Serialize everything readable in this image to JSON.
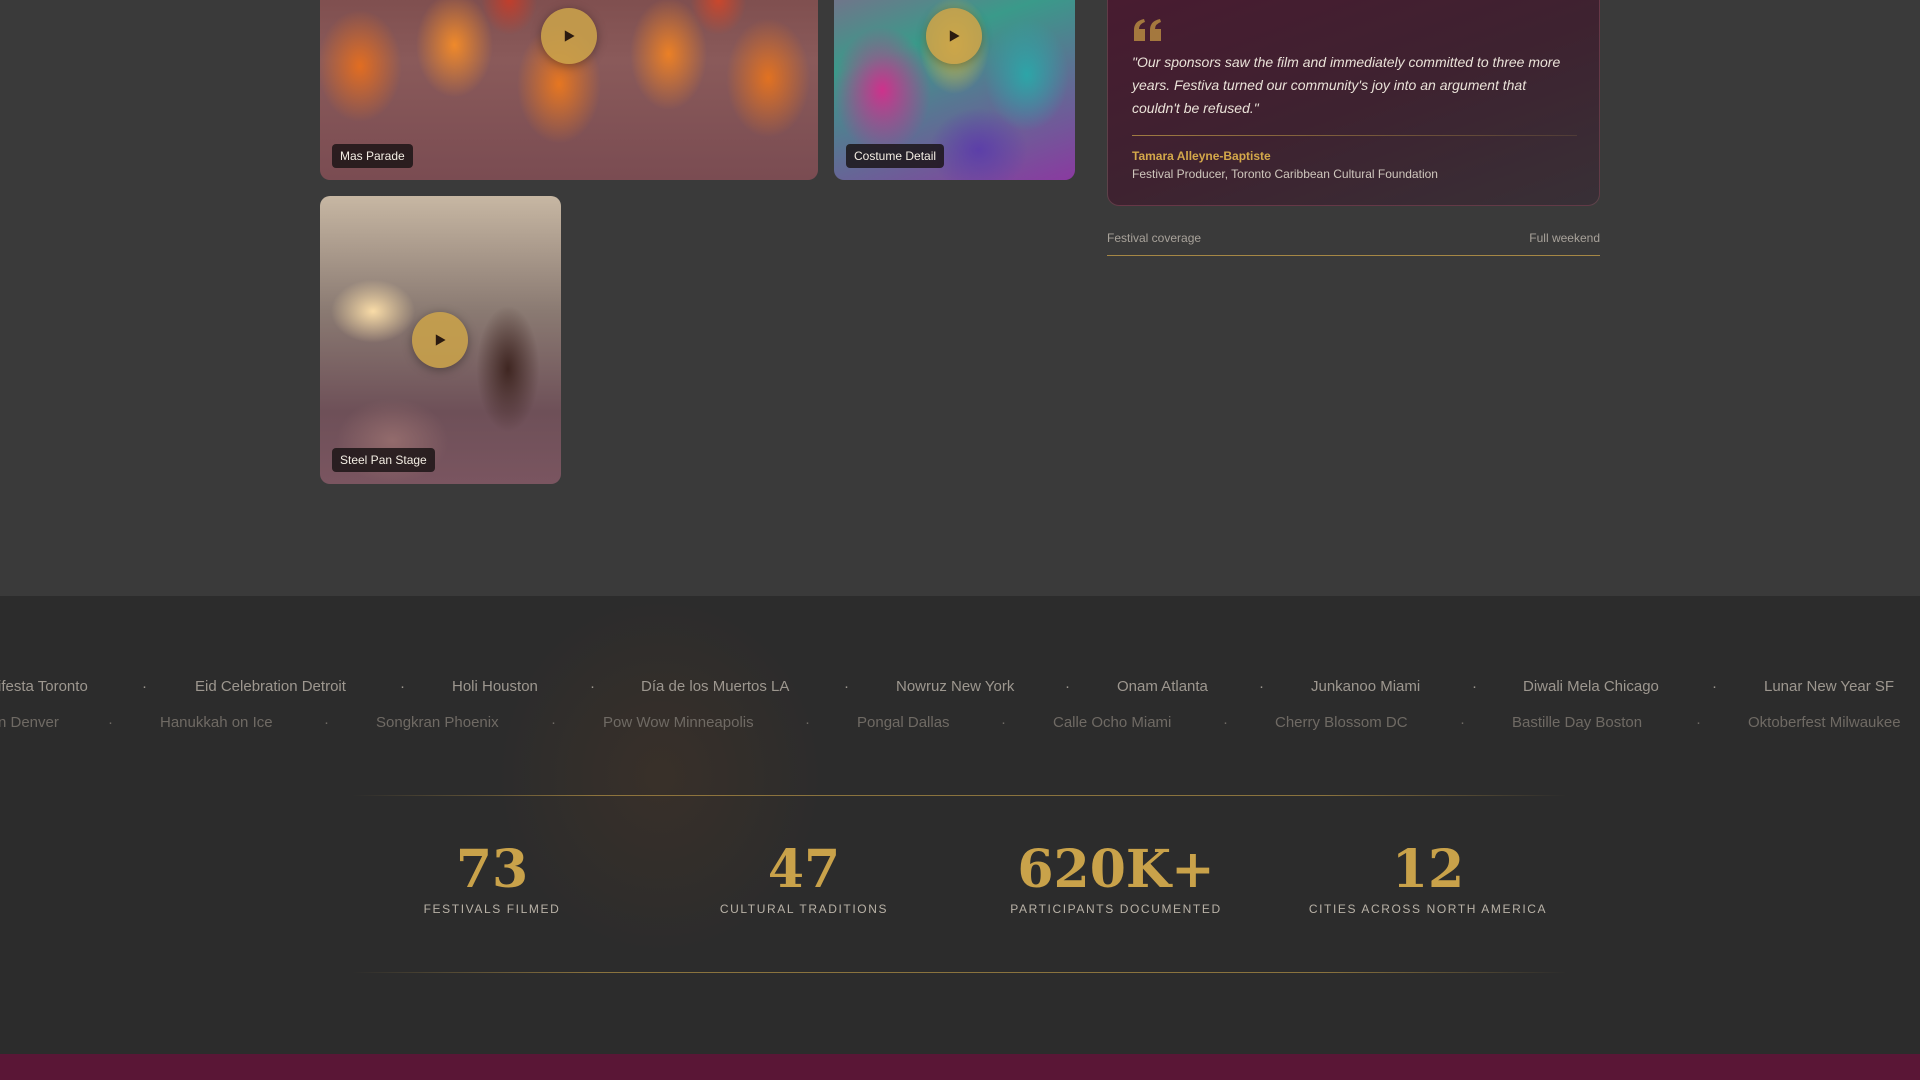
{
  "gallery": {
    "tiles": [
      {
        "caption": "Mas Parade"
      },
      {
        "caption": "Costume Detail"
      },
      {
        "caption": "Steel Pan Stage"
      }
    ]
  },
  "testimonial": {
    "quote": "\"Our sponsors saw the film and immediately committed to three more years. Festiva turned our community's joy into an argument that couldn't be refused.\"",
    "author_name": "Tamara Alleyne-Baptiste",
    "author_role": "Festival Producer, Toronto Caribbean Cultural Foundation"
  },
  "coverage": {
    "label": "Festival coverage",
    "value": "Full weekend"
  },
  "marquee": {
    "row1": [
      "ifesta Toronto",
      "Eid Celebration Detroit",
      "Holi Houston",
      "Día de los Muertos LA",
      "Nowruz New York",
      "Onam Atlanta",
      "Junkanoo Miami",
      "Diwali Mela Chicago",
      "Lunar New Year SF"
    ],
    "row2": [
      "n Denver",
      "Hanukkah on Ice",
      "Songkran Phoenix",
      "Pow Wow Minneapolis",
      "Pongal Dallas",
      "Calle Ocho Miami",
      "Cherry Blossom DC",
      "Bastille Day Boston",
      "Oktoberfest Milwaukee"
    ],
    "separator": "·"
  },
  "stats": [
    {
      "value": "73",
      "label": "FESTIVALS FILMED"
    },
    {
      "value": "47",
      "label": "CULTURAL TRADITIONS"
    },
    {
      "value": "620K+",
      "label": "PARTICIPANTS DOCUMENTED"
    },
    {
      "value": "12",
      "label": "CITIES ACROSS NORTH AMERICA"
    }
  ],
  "colors": {
    "accent_gold": "#c9a24a",
    "testimonial_bg": "#4a1a30",
    "footer_strip": "#5a1636",
    "page_bg": "#3a3a3a",
    "band_bg": "#2c2c2c"
  }
}
